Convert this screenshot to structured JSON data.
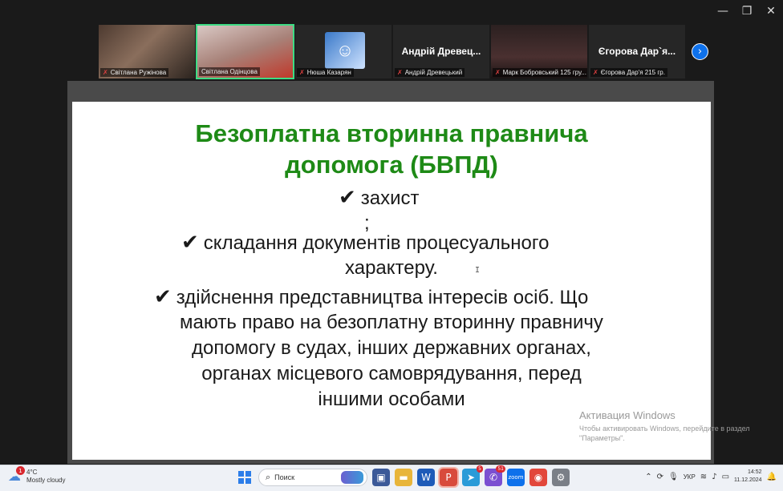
{
  "window_controls": {
    "minimize": "—",
    "restore": "❐",
    "close": "✕"
  },
  "participants": [
    {
      "label": "Світлана Ружінова"
    },
    {
      "label": "Світлана Одінцова"
    },
    {
      "label": "Нюша Казарян"
    },
    {
      "name": "Андрій Древец...",
      "label": "Андрій Древецький"
    },
    {
      "label": "Марк Бобровський 125 гру..."
    },
    {
      "name": "Єгорова Дар`я...",
      "label": "Єгорова Дар'я 215 гр."
    }
  ],
  "slide": {
    "title_line1": "Безоплатна вторинна правнича",
    "title_line2": "допомога (БВПД)",
    "check": "✔",
    "item1": "захист",
    "item1_tail": ";",
    "item2_a": "складання документів процесуального",
    "item2_b": "характеру.",
    "item3_a": "здійснення представництва інтересів осіб. Що",
    "item3_b": "мають право на безоплатну вторинну правничу",
    "item3_c": "допомогу в судах, інших державних органах,",
    "item3_d": "органах місцевого самоврядування, перед",
    "item3_e": "іншими особами"
  },
  "watermark": {
    "title": "Активация Windows",
    "subtitle": "Чтобы активировать Windows, перейдите в раздел \"Параметры\"."
  },
  "taskbar": {
    "weather_temp": "4°C",
    "weather_desc": "Mostly cloudy",
    "weather_badge": "1",
    "search_placeholder": "Поиск",
    "badge_chrome": "5",
    "badge_viber": "51",
    "lang": "УКР",
    "time": "14:52",
    "date": "11.12.2024"
  }
}
